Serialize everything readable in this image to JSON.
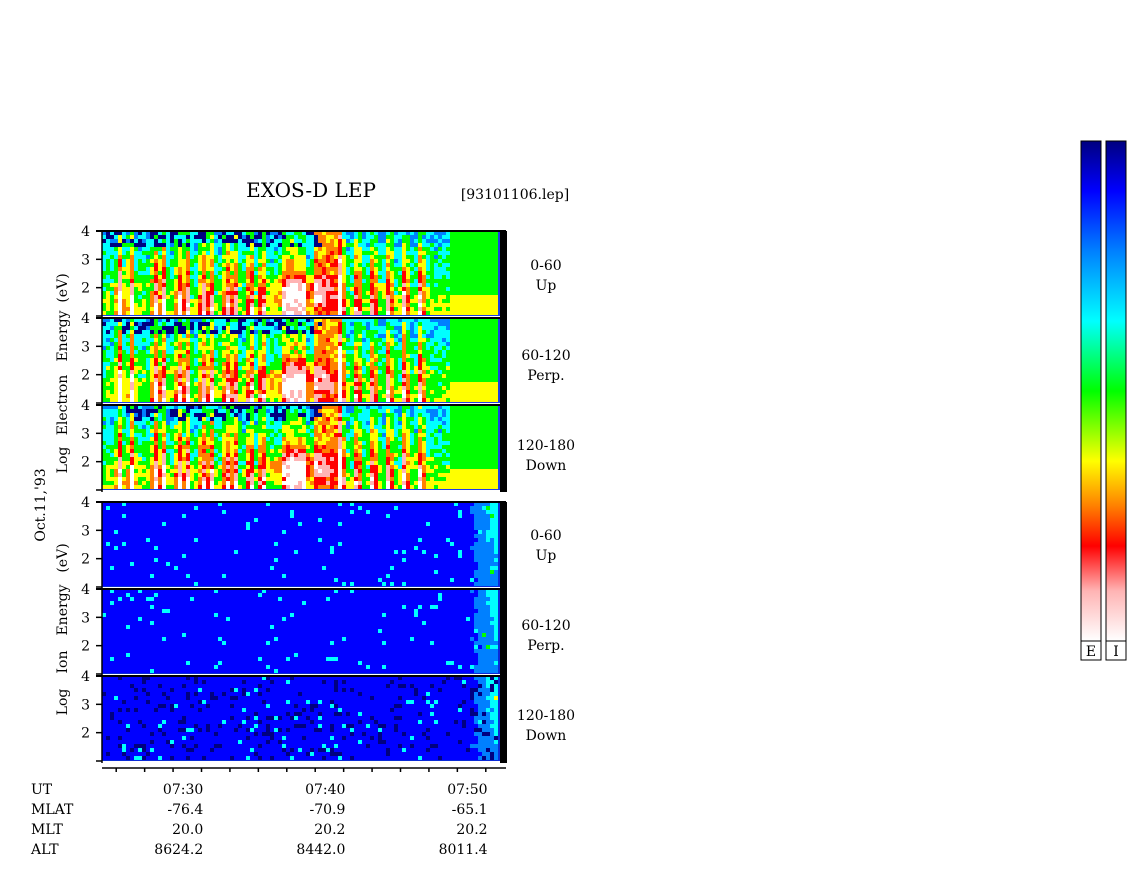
{
  "chart_data": {
    "type": "heatmap",
    "title": "EXOS-D LEP",
    "file_label": "[93101106.lep]",
    "date_label": "Oct.11,'93",
    "groups": [
      {
        "name": "electron",
        "ylabel": "Log Electron Energy (eV)",
        "ylabel_words": [
          "Log",
          "Electron",
          "Energy",
          "(eV)"
        ],
        "panels": [
          {
            "angle": "0-60",
            "direction": "Up"
          },
          {
            "angle": "60-120",
            "direction": "Perp."
          },
          {
            "angle": "120-180",
            "direction": "Down"
          }
        ]
      },
      {
        "name": "ion",
        "ylabel": "Log Ion Energy (eV)",
        "ylabel_words": [
          "Log",
          "Ion",
          "Energy",
          "(eV)"
        ],
        "panels": [
          {
            "angle": "0-60",
            "direction": "Up"
          },
          {
            "angle": "60-120",
            "direction": "Perp."
          },
          {
            "angle": "120-180",
            "direction": "Down"
          }
        ]
      }
    ],
    "y_ticks": [
      "4",
      "3",
      "2"
    ],
    "ylim": [
      1,
      4
    ],
    "x_ticks": [
      "07:30",
      "07:40",
      "07:50"
    ],
    "xlim": [
      "07:24",
      "07:52"
    ],
    "colorbars": [
      {
        "label": "E",
        "target": "electron"
      },
      {
        "label": "I",
        "target": "ion"
      }
    ],
    "colormap": [
      "#ffffff",
      "#ffb4b4",
      "#ff0000",
      "#ff8000",
      "#ffff00",
      "#00ff00",
      "#00ffff",
      "#0080ff",
      "#0000ff",
      "#000080"
    ],
    "footer": {
      "rows": [
        {
          "label": "UT",
          "values": [
            "07:30",
            "07:40",
            "07:50"
          ]
        },
        {
          "label": "MLAT",
          "values": [
            "-76.4",
            "-70.9",
            "-65.1"
          ]
        },
        {
          "label": "MLT",
          "values": [
            "20.0",
            "20.2",
            "20.2"
          ]
        },
        {
          "label": "ALT",
          "values": [
            "8624.2",
            "8442.0",
            "8011.4"
          ]
        }
      ]
    }
  }
}
